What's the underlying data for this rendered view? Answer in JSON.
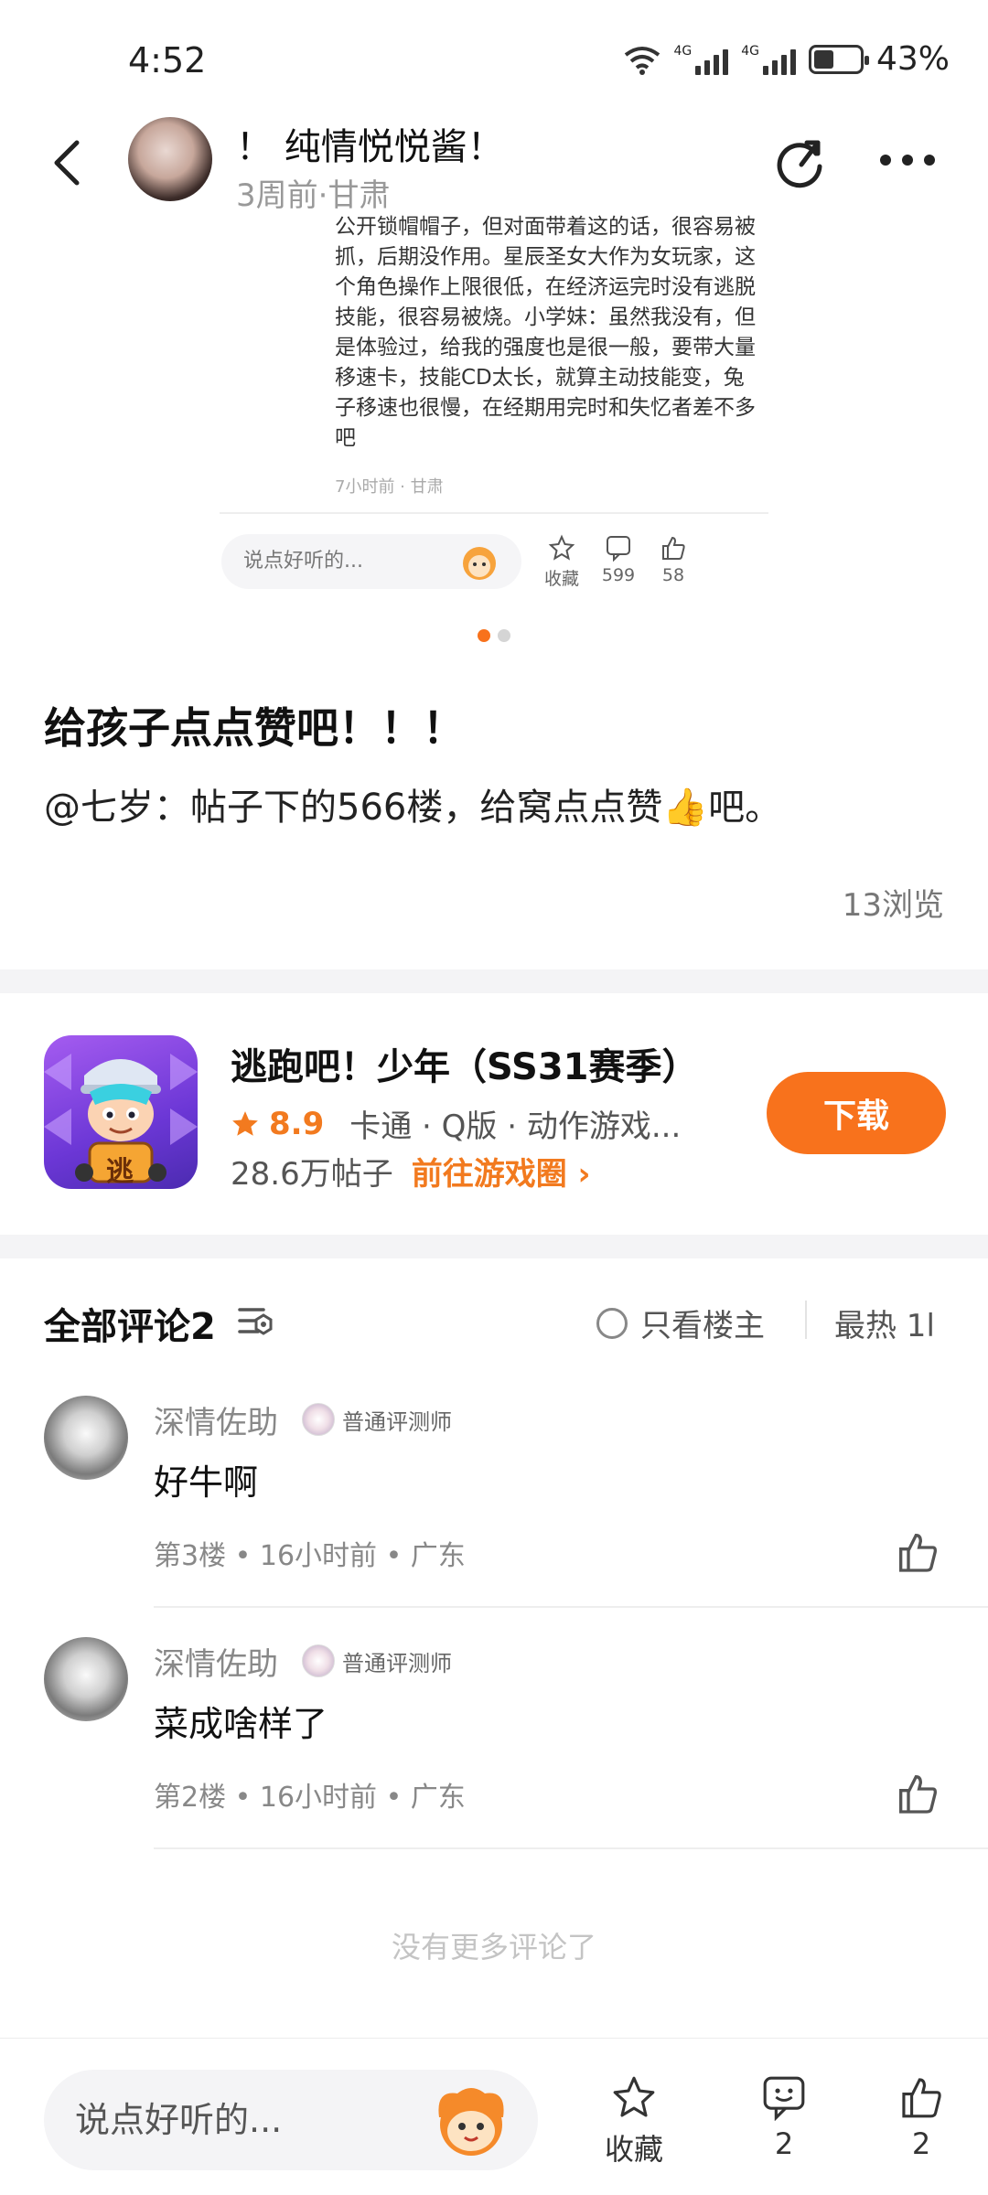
{
  "status_bar": {
    "time": "4:52",
    "network1": "4G",
    "network2": "4G",
    "battery": "43%",
    "battery_level": 0.43
  },
  "header": {
    "author_name": "！ 纯情悦悦酱！",
    "meta": "3周前·甘肃"
  },
  "embedded": {
    "text": "公开锁帽帽子，但对面带着这的话，很容易被抓，后期没作用。星辰圣女大作为女玩家，这个角色操作上限很低，在经济运完时没有逃脱技能，很容易被烧。小学妹：虽然我没有，但是体验过，给我的强度也是很一般，要带大量移速卡，技能CD太长，就算主动技能变，兔子移速也很慢，在经期用完时和失忆者差不多吧",
    "meta": "7小时前 · 甘肃",
    "input_placeholder": "说点好听的...",
    "collect_label": "收藏",
    "comment_count": "599",
    "like_count": "58"
  },
  "post": {
    "title": "给孩子点点赞吧！！！",
    "body": "@七岁：帖子下的566楼，给窝点点赞👍吧。",
    "views": "13浏览"
  },
  "game": {
    "name": "逃跑吧！少年（SS31赛季）",
    "icon_char": "逃",
    "rating": "8.9",
    "tags": "卡通 · Q版 · 动作游戏...",
    "posts": "28.6万帖子",
    "goto": "前往游戏圈",
    "download": "下载"
  },
  "comments_header": {
    "title": "全部评论2",
    "only_op": "只看楼主",
    "sort": "最热 1l"
  },
  "comments": [
    {
      "name": "深情佐助",
      "badge": "普通评测师",
      "text": "好牛啊",
      "meta": "第3楼 • 16小时前 • 广东"
    },
    {
      "name": "深情佐助",
      "badge": "普通评测师",
      "text": "菜成啥样了",
      "meta": "第2楼 • 16小时前 • 广东"
    }
  ],
  "no_more": "没有更多评论了",
  "bottom_bar": {
    "input_placeholder": "说点好听的...",
    "collect_label": "收藏",
    "comment_count": "2",
    "like_count": "2"
  },
  "colors": {
    "accent": "#f8721c",
    "rating": "#f27a1f"
  }
}
